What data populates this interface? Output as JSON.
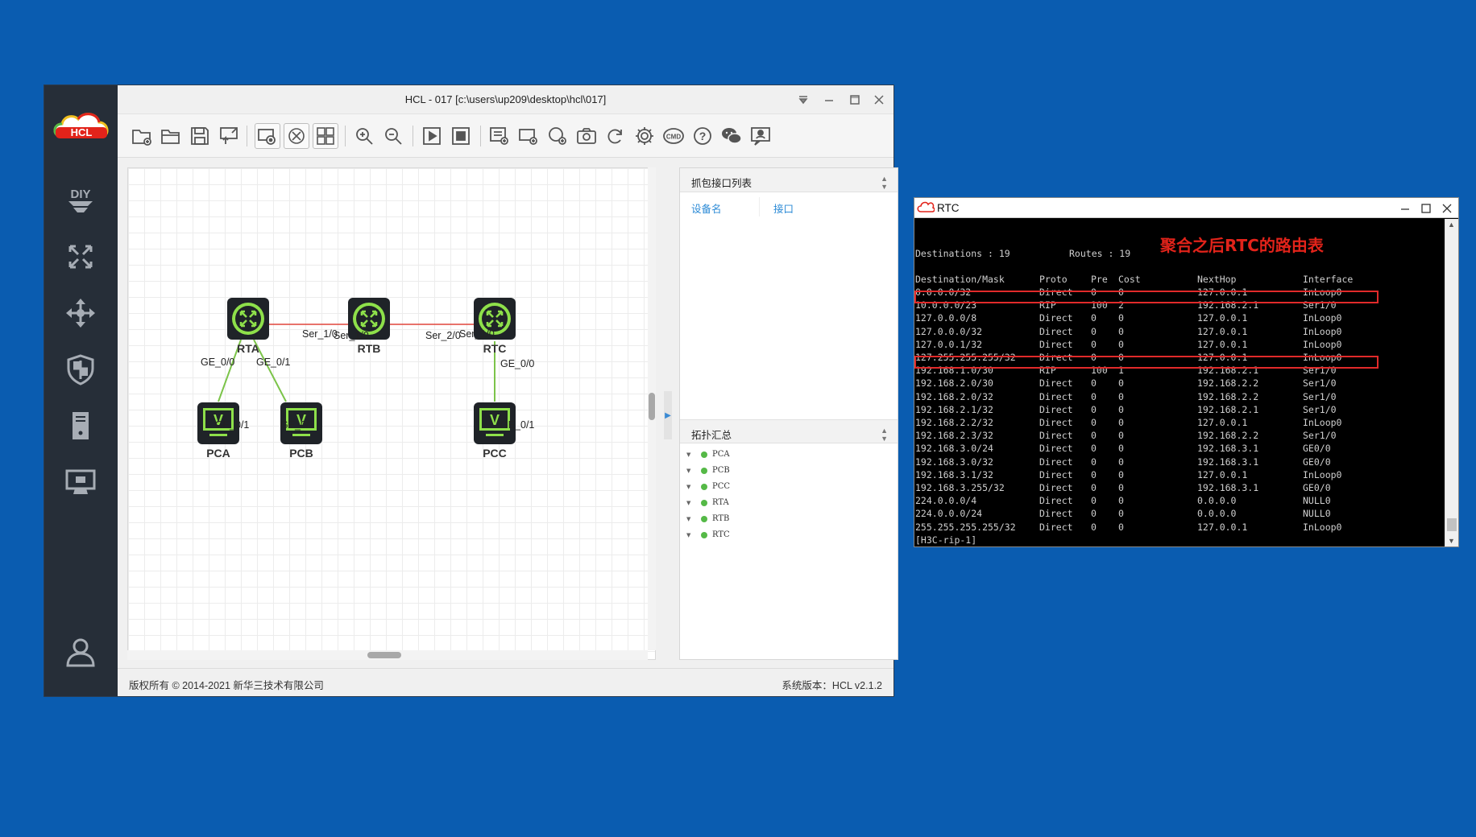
{
  "hcl": {
    "title": "HCL - 017 [c:\\users\\up209\\desktop\\hcl\\017]",
    "logo_text": "HCL",
    "side_icons": [
      "diy-icon",
      "network-icon",
      "move-icon",
      "security-icon",
      "server-icon",
      "monitor-icon",
      "user-icon"
    ],
    "canvas": {
      "devices": [
        {
          "name": "RTA",
          "type": "router"
        },
        {
          "name": "RTB",
          "type": "router"
        },
        {
          "name": "RTC",
          "type": "router"
        },
        {
          "name": "PCA",
          "type": "pc"
        },
        {
          "name": "PCB",
          "type": "pc"
        },
        {
          "name": "PCC",
          "type": "pc"
        }
      ],
      "ports": {
        "rta_ser": "Ser_1/0",
        "rtb_ser1": "Ser_1/0",
        "rtb_ser2": "Ser_2/0",
        "rtc_ser": "Ser_1/0",
        "rta_ge0": "GE_0/0",
        "rta_ge1": "GE_0/1",
        "pca_ge": "GE_0/1",
        "pcb_ge": "GE_0/1",
        "rtc_ge0": "GE_0/0",
        "pcc_ge": "GE_0/1"
      },
      "pc_badge": "V"
    },
    "capture_panel": {
      "title": "抓包接口列表",
      "col_device": "设备名",
      "col_interface": "接口"
    },
    "topology_panel": {
      "title": "拓扑汇总",
      "items": [
        "PCA",
        "PCB",
        "PCC",
        "RTA",
        "RTB",
        "RTC"
      ]
    },
    "status": {
      "copyright": "版权所有 © 2014-2021 新华三技术有限公司",
      "version": "系统版本：HCL v2.1.2"
    }
  },
  "rtc": {
    "title": "RTC",
    "summary": {
      "destinations": "Destinations : 19",
      "routes": "Routes : 19"
    },
    "annotation": "聚合之后RTC的路由表",
    "headers": [
      "Destination/Mask",
      "Proto",
      "Pre",
      "Cost",
      "NextHop",
      "Interface"
    ],
    "routes": [
      [
        "0.0.0.0/32",
        "Direct",
        "0",
        "0",
        "127.0.0.1",
        "InLoop0"
      ],
      [
        "10.0.0.0/23",
        "RIP",
        "100",
        "2",
        "192.168.2.1",
        "Ser1/0"
      ],
      [
        "127.0.0.0/8",
        "Direct",
        "0",
        "0",
        "127.0.0.1",
        "InLoop0"
      ],
      [
        "127.0.0.0/32",
        "Direct",
        "0",
        "0",
        "127.0.0.1",
        "InLoop0"
      ],
      [
        "127.0.0.1/32",
        "Direct",
        "0",
        "0",
        "127.0.0.1",
        "InLoop0"
      ],
      [
        "127.255.255.255/32",
        "Direct",
        "0",
        "0",
        "127.0.0.1",
        "InLoop0"
      ],
      [
        "192.168.1.0/30",
        "RIP",
        "100",
        "1",
        "192.168.2.1",
        "Ser1/0"
      ],
      [
        "192.168.2.0/30",
        "Direct",
        "0",
        "0",
        "192.168.2.2",
        "Ser1/0"
      ],
      [
        "192.168.2.0/32",
        "Direct",
        "0",
        "0",
        "192.168.2.2",
        "Ser1/0"
      ],
      [
        "192.168.2.1/32",
        "Direct",
        "0",
        "0",
        "192.168.2.1",
        "Ser1/0"
      ],
      [
        "192.168.2.2/32",
        "Direct",
        "0",
        "0",
        "127.0.0.1",
        "InLoop0"
      ],
      [
        "192.168.2.3/32",
        "Direct",
        "0",
        "0",
        "192.168.2.2",
        "Ser1/0"
      ],
      [
        "192.168.3.0/24",
        "Direct",
        "0",
        "0",
        "192.168.3.1",
        "GE0/0"
      ],
      [
        "192.168.3.0/32",
        "Direct",
        "0",
        "0",
        "192.168.3.1",
        "GE0/0"
      ],
      [
        "192.168.3.1/32",
        "Direct",
        "0",
        "0",
        "127.0.0.1",
        "InLoop0"
      ],
      [
        "192.168.3.255/32",
        "Direct",
        "0",
        "0",
        "192.168.3.1",
        "GE0/0"
      ],
      [
        "224.0.0.0/4",
        "Direct",
        "0",
        "0",
        "0.0.0.0",
        "NULL0"
      ],
      [
        "224.0.0.0/24",
        "Direct",
        "0",
        "0",
        "0.0.0.0",
        "NULL0"
      ],
      [
        "255.255.255.255/32",
        "Direct",
        "0",
        "0",
        "127.0.0.1",
        "InLoop0"
      ]
    ],
    "highlighted_routes": [
      "10.0.0.0/23",
      "192.168.1.0/30"
    ],
    "prompt_lines": [
      "[H3C-rip-1]",
      "[H3C-rip-1]"
    ],
    "highlight_color": "#e12a2a",
    "cursor_color": "#3ee04a"
  },
  "colors": {
    "desktop": "#0a5cb0",
    "sidebar": "#262e38",
    "serial_link": "#e0453a",
    "ethernet_link": "#7cc44a",
    "device_green": "#8ee04a",
    "link_blue": "#2b8ad6"
  }
}
